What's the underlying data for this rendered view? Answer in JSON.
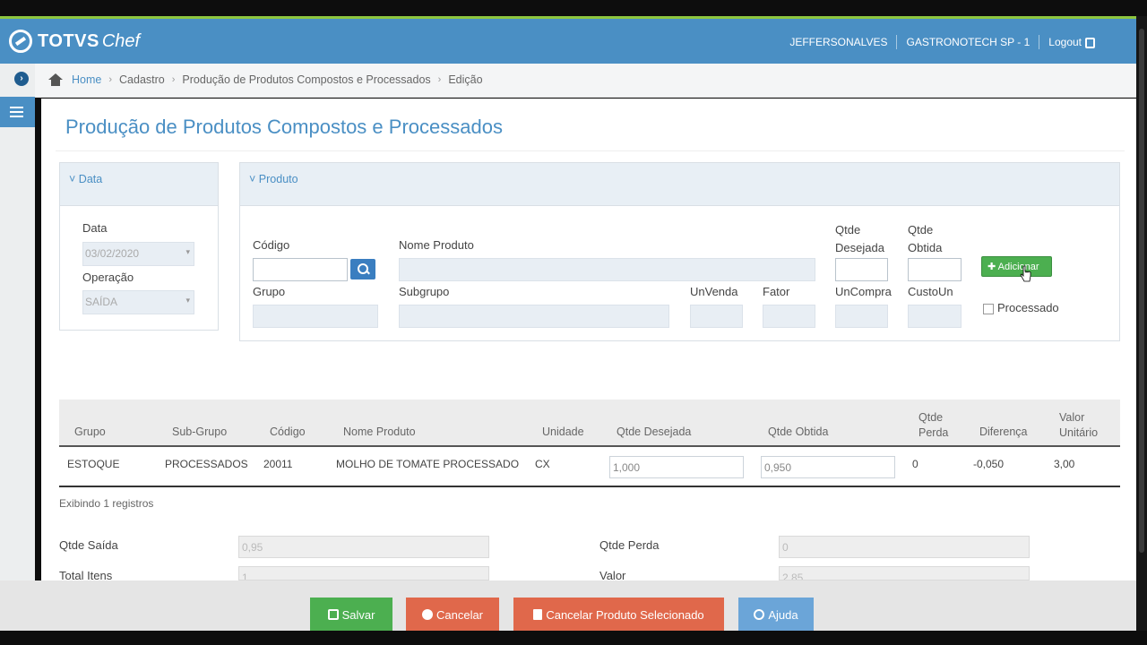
{
  "header": {
    "brand": "TOTVS",
    "brand_suffix": "Chef",
    "user": "JEFFERSONALVES",
    "company": "GASTRONOTECH SP - 1",
    "logout": "Logout"
  },
  "breadcrumb": [
    "Home",
    "Cadastro",
    "Produção de Produtos Compostos e Processados",
    "Edição"
  ],
  "page_title": "Produção de Produtos Compostos e Processados",
  "data_panel": {
    "title": "Data",
    "data_label": "Data",
    "data_value": "03/02/2020",
    "operacao_label": "Operação",
    "operacao_value": "SAÍDA"
  },
  "produto_panel": {
    "title": "Produto",
    "codigo_label": "Código",
    "nome_label": "Nome Produto",
    "qtde_desejada_label_1": "Qtde",
    "qtde_desejada_label_2": "Desejada",
    "qtde_obtida_label_1": "Qtde",
    "qtde_obtida_label_2": "Obtida",
    "add_button": "Adicionar",
    "grupo_label": "Grupo",
    "subgrupo_label": "Subgrupo",
    "unvenda_label": "UnVenda",
    "fator_label": "Fator",
    "uncompra_label": "UnCompra",
    "custoun_label": "CustoUn",
    "processado_label": "Processado"
  },
  "grid": {
    "headers": {
      "grupo": "Grupo",
      "subgrupo": "Sub-Grupo",
      "codigo": "Código",
      "nome": "Nome Produto",
      "unidade": "Unidade",
      "qtde_desejada": "Qtde Desejada",
      "qtde_obtida": "Qtde Obtida",
      "qtde_perda_1": "Qtde",
      "qtde_perda_2": "Perda",
      "diferenca": "Diferença",
      "valor_unit_1": "Valor",
      "valor_unit_2": "Unitário"
    },
    "rows": [
      {
        "grupo": "ESTOQUE",
        "subgrupo": "PROCESSADOS",
        "codigo": "20011",
        "nome": "MOLHO DE TOMATE PROCESSADO",
        "unidade": "CX",
        "qtde_desejada": "1,000",
        "qtde_obtida": "0,950",
        "qtde_perda": "0",
        "diferenca": "-0,050",
        "valor_unitario": "3,00"
      }
    ],
    "showing": "Exibindo 1 registros"
  },
  "totals": {
    "qtde_saida_label": "Qtde Saída",
    "qtde_saida_value": "0,95",
    "total_itens_label": "Total Itens",
    "total_itens_value": "1",
    "qtde_perda_label": "Qtde Perda",
    "qtde_perda_value": "0",
    "valor_label": "Valor",
    "valor_value": "2,85"
  },
  "footer": {
    "salvar": "Salvar",
    "cancelar": "Cancelar",
    "cancelar_produto": "Cancelar Produto Selecionado",
    "ajuda": "Ajuda"
  },
  "colors": {
    "primary": "#4a8fc4",
    "success": "#4caf50",
    "danger": "#e0684b",
    "info": "#6ba5d8",
    "accent_line": "#8dc63f"
  }
}
